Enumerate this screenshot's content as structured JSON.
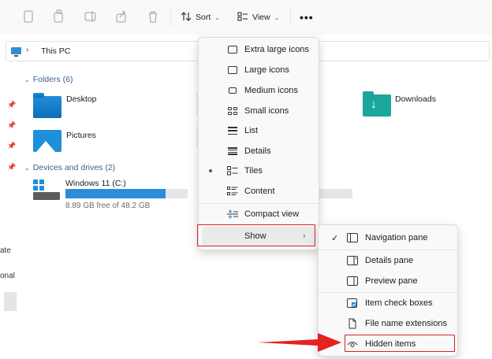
{
  "toolbar": {
    "sort_label": "Sort",
    "view_label": "View",
    "more_label": "•••",
    "icons": [
      "new-icon",
      "copy-icon",
      "rename-icon",
      "share-icon",
      "delete-icon",
      "sort-icon",
      "view-icon",
      "chevron-down-icon"
    ]
  },
  "address": {
    "crumb": "This PC",
    "separator": "›"
  },
  "left_nav": {
    "stub1": "ate",
    "stub2": "onal"
  },
  "folders": {
    "title": "Folders (6)",
    "items": [
      {
        "label": "Desktop"
      },
      {
        "label": "Pictures"
      },
      {
        "label": "Downloads"
      }
    ]
  },
  "devices": {
    "title": "Devices and drives (2)",
    "drive": {
      "name": "Windows 11 (C:)",
      "free": "8.89 GB free of 48.2 GB",
      "used_fraction": 0.82
    }
  },
  "view_menu": {
    "items": [
      {
        "label": "Extra large icons",
        "icon": "monitor-icon"
      },
      {
        "label": "Large icons",
        "icon": "monitor-icon"
      },
      {
        "label": "Medium icons",
        "icon": "monitor-icon"
      },
      {
        "label": "Small icons",
        "icon": "grid-icon"
      },
      {
        "label": "List",
        "icon": "list-icon"
      },
      {
        "label": "Details",
        "icon": "details-icon"
      },
      {
        "label": "Tiles",
        "icon": "tiles-icon",
        "selected": true
      },
      {
        "label": "Content",
        "icon": "content-icon"
      }
    ],
    "compact": {
      "label": "Compact view",
      "icon": "compact-icon"
    },
    "show": {
      "label": "Show",
      "chevron": "›"
    }
  },
  "show_menu": {
    "items": [
      {
        "label": "Navigation pane",
        "checked": true,
        "icon": "navigation-pane-icon"
      },
      {
        "label": "Details pane",
        "icon": "details-pane-icon"
      },
      {
        "label": "Preview pane",
        "icon": "preview-pane-icon"
      },
      {
        "label": "Item check boxes",
        "icon": "checkbox-icon"
      },
      {
        "label": "File name extensions",
        "icon": "file-icon"
      },
      {
        "label": "Hidden items",
        "icon": "eye-icon"
      }
    ],
    "check_mark": "✓"
  },
  "colors": {
    "highlight": "#d62525",
    "accent": "#2a8ddb",
    "arrow": "#e52222"
  }
}
